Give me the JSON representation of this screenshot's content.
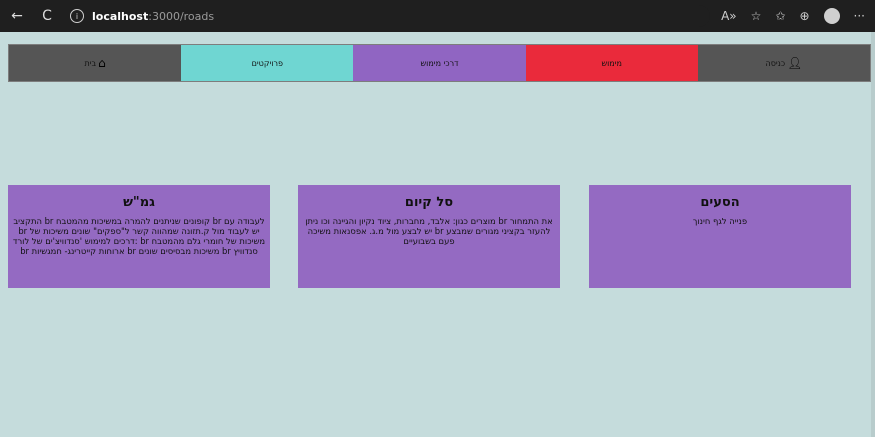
{
  "browser": {
    "back": "←",
    "refresh": "C",
    "info": "i",
    "url_host": "localhost",
    "url_path": ":3000/roads",
    "icons": [
      "read-aloud-icon",
      "favorites-icon",
      "collections-icon",
      "extensions-icon",
      "profile-icon",
      "more-icon"
    ]
  },
  "colors": {
    "page_bg": "#c5dcdc",
    "nav_gray": "#555555",
    "nav_red": "#ea2a3b",
    "nav_purple": "#9065c2",
    "nav_cyan": "#6fd6d2",
    "card_purple": "#946ac2"
  },
  "navbar": {
    "items": [
      {
        "label": "כניסה",
        "icon": "user-icon"
      },
      {
        "label": "מימוש"
      },
      {
        "label": "דרכי מימוש"
      },
      {
        "label": "פרויקטים"
      },
      {
        "label": "בית",
        "icon": "home-icon"
      }
    ]
  },
  "cards": [
    {
      "title": "הסעים",
      "text": "פנייה לגף חינוך"
    },
    {
      "title": "סל קיום",
      "text": "את התמחור br מוצרים כגון: אלבד, מחברות, ציוד נקיון והגיינה וכו ניתן להעזר בקציני מגורים שמבצע br יש לבצע מול מ.ג. אפסנאות משיכה פעם בשבועיים"
    },
    {
      "title": "גמ\"ש",
      "text": "לעבודה עם br קופונים שניתנים להמרה במשיכות מהמטבח br התקציב יש לעבוד מול ק.תזונה שמהווה קשר ל\"ספקים\" שונים משיכות של br משיכות של חומרי גלם מהמטבח br :דרכים למימוש 'סנדוויצ'ים של לורד סנדוויץ br משיכות מבסיסים שונים br ארוחות קייטרינג- חמגשיות br"
    }
  ]
}
